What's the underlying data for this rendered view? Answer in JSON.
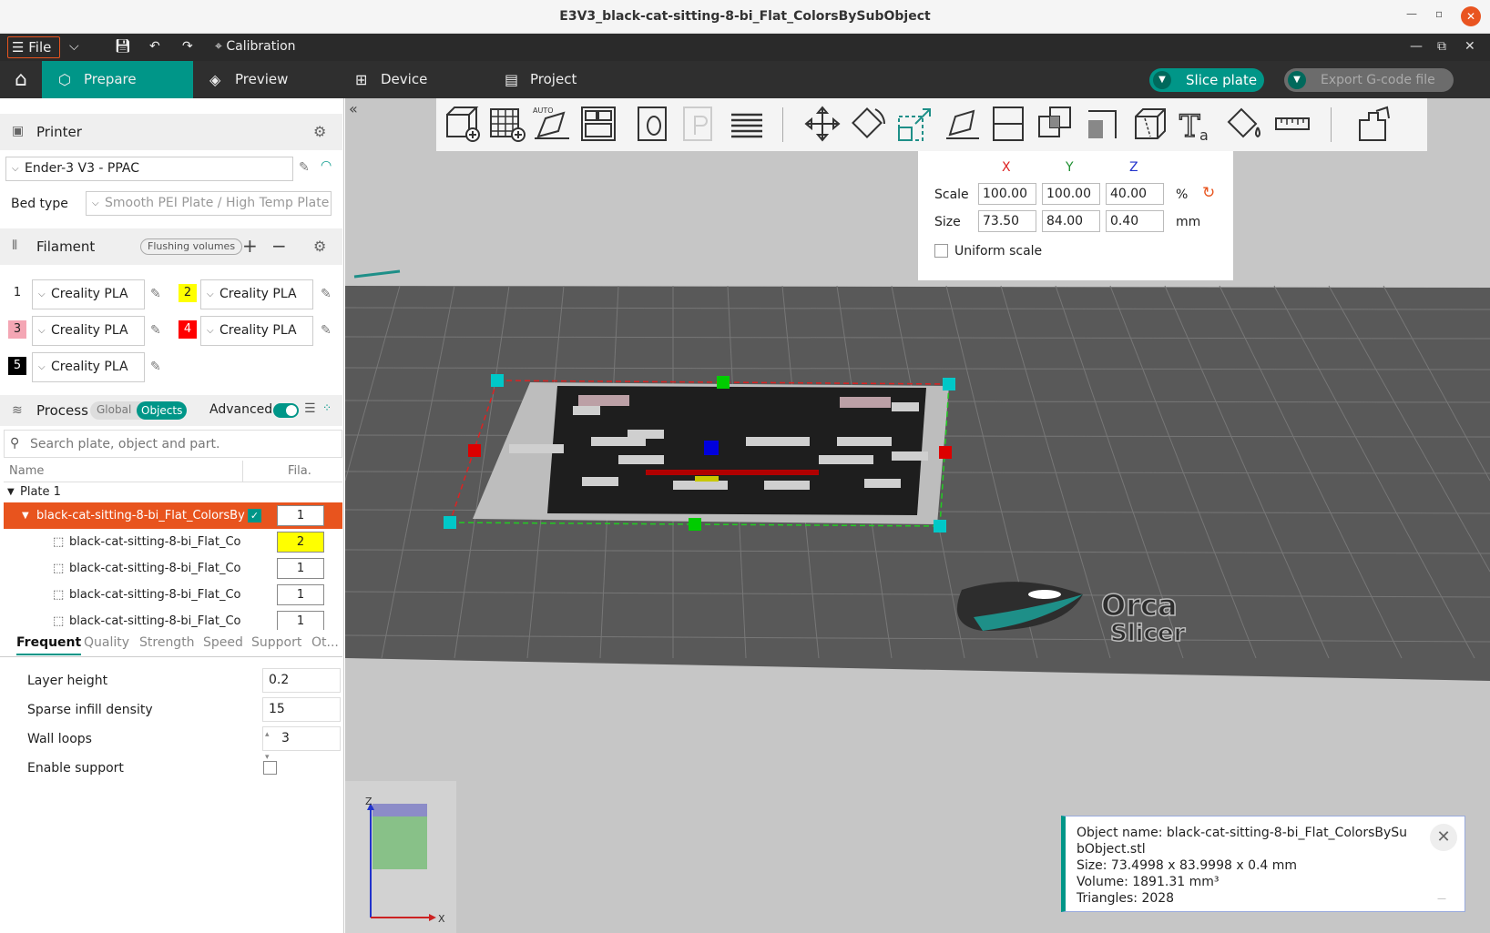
{
  "window": {
    "title": "E3V3_black-cat-sitting-8-bi_Flat_ColorsBySubObject"
  },
  "menubar": {
    "file_label": "File",
    "calibration_label": "Calibration"
  },
  "tabs": [
    {
      "label": "Prepare",
      "active": true
    },
    {
      "label": "Preview"
    },
    {
      "label": "Device"
    },
    {
      "label": "Project"
    }
  ],
  "actions": {
    "slice_label": "Slice plate",
    "export_label": "Export G-code file"
  },
  "printer": {
    "header": "Printer",
    "selected": "Ender-3 V3 - PPAC",
    "bed_type_label": "Bed type",
    "bed_type_value": "Smooth PEI Plate / High Temp Plate"
  },
  "filament": {
    "header": "Filament",
    "flushing_label": "Flushing volumes",
    "slots": [
      {
        "index": "1",
        "name": "Creality  PLA",
        "color": "#ffffff"
      },
      {
        "index": "2",
        "name": "Creality  PLA",
        "color": "#ffff00"
      },
      {
        "index": "3",
        "name": "Creality  PLA",
        "color": "#f4a6b4"
      },
      {
        "index": "4",
        "name": "Creality  PLA",
        "color": "#ff0000"
      },
      {
        "index": "5",
        "name": "Creality  PLA",
        "color": "#000000"
      }
    ]
  },
  "process": {
    "header": "Process",
    "global_label": "Global",
    "objects_label": "Objects",
    "advanced_label": "Advanced",
    "search_placeholder": "Search plate, object and part.",
    "col_name": "Name",
    "col_fila": "Fila.",
    "plate_label": "Plate 1",
    "object": {
      "name": "black-cat-sitting-8-bi_Flat_ColorsBy",
      "fila": "1"
    },
    "parts": [
      {
        "name": "black-cat-sitting-8-bi_Flat_Co",
        "fila": "2"
      },
      {
        "name": "black-cat-sitting-8-bi_Flat_Co",
        "fila": "1"
      },
      {
        "name": "black-cat-sitting-8-bi_Flat_Co",
        "fila": "1"
      },
      {
        "name": "black-cat-sitting-8-bi_Flat_Co",
        "fila": "1"
      }
    ]
  },
  "param_tabs": [
    "Frequent",
    "Quality",
    "Strength",
    "Speed",
    "Support",
    "Ot..."
  ],
  "params": {
    "layer_height_label": "Layer height",
    "layer_height": "0.2",
    "infill_label": "Sparse infill density",
    "infill": "15",
    "wall_loops_label": "Wall loops",
    "wall_loops": "3",
    "support_label": "Enable support"
  },
  "scale_panel": {
    "x": "X",
    "y": "Y",
    "z": "Z",
    "scale_label": "Scale",
    "scale_x": "100.00",
    "scale_y": "100.00",
    "scale_z": "40.00",
    "scale_unit": "%",
    "size_label": "Size",
    "size_x": "73.50",
    "size_y": "84.00",
    "size_z": "0.40",
    "size_unit": "mm",
    "uniform_label": "Uniform scale"
  },
  "info": {
    "name": "Object name: black-cat-sitting-8-bi_Flat_ColorsBySu",
    "name2": "bObject.stl",
    "size": "Size: 73.4998 x 83.9998 x 0.4 mm",
    "volume": "Volume: 1891.31 mm³",
    "triangles": "Triangles: 2028"
  },
  "logo": {
    "line1": "Orca",
    "line2": "Slicer"
  },
  "axes": {
    "x": "X",
    "z": "Z"
  },
  "colors": {
    "accent": "#009688",
    "selection": "#e8541e"
  }
}
